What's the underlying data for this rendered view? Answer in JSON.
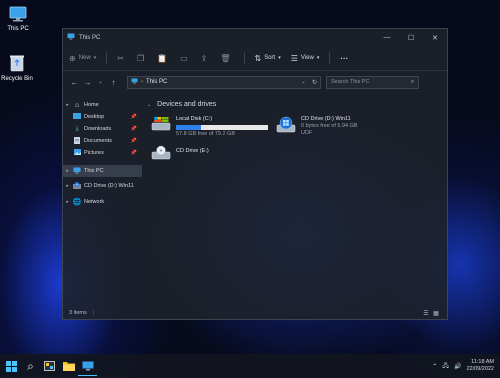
{
  "desktop": {
    "icons": [
      {
        "label": "This PC",
        "icon": "monitor-icon"
      },
      {
        "label": "Recycle Bin",
        "icon": "recycle-bin-icon"
      }
    ]
  },
  "window": {
    "title": "This PC",
    "toolbar": {
      "new_label": "New",
      "sort_label": "Sort",
      "view_label": "View",
      "more_label": "···"
    },
    "address": {
      "path": "This PC",
      "search_placeholder": "Search This PC"
    },
    "nav_pane": {
      "items": [
        {
          "label": "Home",
          "icon": "home-icon"
        },
        {
          "label": "Desktop",
          "icon": "desktop-folder-icon"
        },
        {
          "label": "Downloads",
          "icon": "downloads-icon"
        },
        {
          "label": "Documents",
          "icon": "documents-icon"
        },
        {
          "label": "Pictures",
          "icon": "pictures-icon"
        },
        {
          "label": "This PC",
          "icon": "monitor-icon"
        },
        {
          "label": "CD Drive (D:) Win11",
          "icon": "cd-drive-icon"
        },
        {
          "label": "Network",
          "icon": "network-icon"
        }
      ]
    },
    "main": {
      "group_header": "Devices and drives",
      "drives": [
        {
          "name": "Local Disk (C:)",
          "free_text": "57.8 GB free of 79.2 GB",
          "used_fraction": 0.27
        },
        {
          "name": "CD Drive (D:) Win11",
          "free_text": "0 bytes free of 5.94 GB",
          "fs": "UDF"
        },
        {
          "name": "CD Drive (E:)"
        }
      ]
    },
    "status": {
      "items_text": "3 items"
    }
  },
  "taskbar": {
    "time": "11:18 AM",
    "date": "22/09/2022"
  },
  "colors": {
    "accent": "#2f80ed",
    "window_bg": "#1e222a",
    "desktop_bg": "#060a1a"
  }
}
